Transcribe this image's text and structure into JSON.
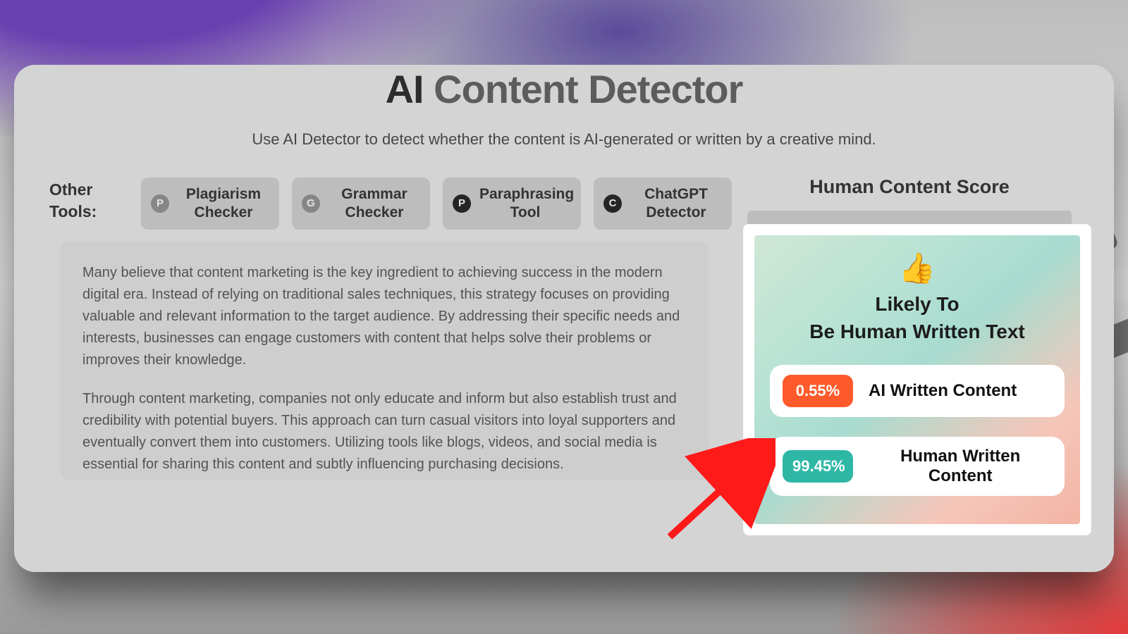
{
  "hero": {
    "title_ai": "AI",
    "title_rest": " Content Detector",
    "subtitle": "Use AI Detector to detect whether the content is AI-generated or written by a creative mind."
  },
  "toolbar": {
    "label": "Other Tools:",
    "items": [
      {
        "badge_letter": "P",
        "badge_color": "#8a8a8a",
        "label": "Plagiarism Checker"
      },
      {
        "badge_letter": "G",
        "badge_color": "#8a8a8a",
        "label": "Grammar Checker"
      },
      {
        "badge_letter": "P",
        "badge_color": "#111111",
        "label": "Paraphrasing Tool"
      },
      {
        "badge_letter": "C",
        "badge_color": "#111111",
        "label": "ChatGPT Detector"
      }
    ]
  },
  "content": {
    "p1": "Many believe that content marketing is the key ingredient to achieving success in the modern digital era. Instead of relying on traditional sales techniques, this strategy focuses on providing valuable and relevant information to the target audience. By addressing their specific needs and interests, businesses can engage customers with content that helps solve their problems or improves their knowledge.",
    "p2": "Through content marketing, companies not only educate and inform but also establish trust and credibility with potential buyers. This approach can turn casual visitors into loyal supporters and eventually convert them into customers. Utilizing tools like blogs, videos, and social media is essential for sharing this content and subtly influencing purchasing decisions."
  },
  "score": {
    "title": "Human Content Score",
    "thumb_emoji": "👍",
    "verdict_line1": "Likely To",
    "verdict_line2": "Be Human Written Text",
    "ai_pct": "0.55%",
    "ai_label": "AI Written Content",
    "human_pct": "99.45%",
    "human_label": "Human Written Content"
  },
  "colors": {
    "orange": "#ff5a2b",
    "teal": "#2fb7a6"
  }
}
